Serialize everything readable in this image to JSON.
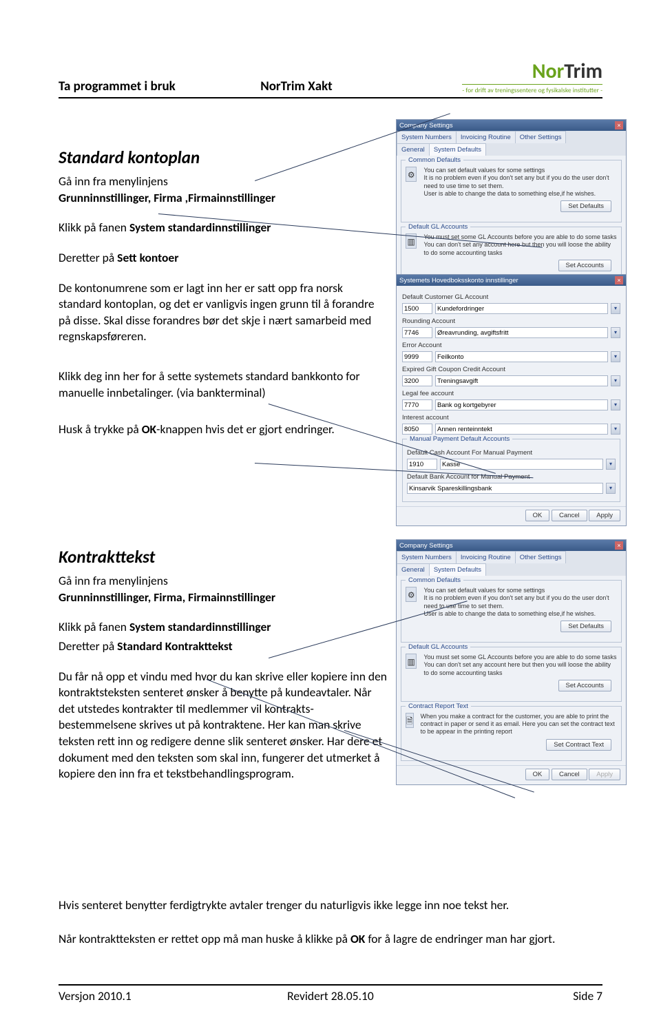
{
  "header": {
    "left": "Ta programmet i bruk",
    "mid": "NorTrim Xakt",
    "logo_nor": "Nor",
    "logo_trim": "Trim",
    "logo_sub": "- for drift av treningssentere og fysikalske institutter -"
  },
  "section1": {
    "title": "Standard kontoplan",
    "p1a": "Gå inn fra menylinjens",
    "p1b": "Grunninnstillinger, Firma ,Firmainnstillinger",
    "p2a": "Klikk på fanen ",
    "p2b": "System standardinnstillinger",
    "p3a": "Deretter på ",
    "p3b": "Sett kontoer",
    "p4": "De kontonumrene som er lagt inn her er satt opp fra norsk standard kontoplan, og det er vanligvis ingen grunn til å forandre på disse. Skal disse forandres bør det skje i nært samarbeid med regnskapsføreren.",
    "p5": "Klikk deg inn her for å sette systemets standard bankkonto for manuelle innbetalinger. (via bankterminal)",
    "p6a": "Husk å trykke på ",
    "p6b": "OK",
    "p6c": "-knappen hvis det er gjort endringer."
  },
  "section2": {
    "title": "Kontrakttekst",
    "p1a": "Gå inn fra menylinjens",
    "p1b": "Grunninnstillinger, Firma, Firmainnstillinger",
    "p2a": "Klikk på fanen ",
    "p2b": "System standardinnstillinger",
    "p3a": "Deretter på ",
    "p3b": "Standard Kontrakttekst",
    "p4": "Du får nå opp et vindu med hvor du kan skrive eller kopiere inn den kontraktsteksten senteret ønsker å benytte på kundeavtaler. Når det utstedes kontrakter til medlemmer vil kontrakts-bestemmelsene skrives ut på kontraktene. Her kan man skrive teksten rett inn og redigere denne slik senteret ønsker. Har dere et dokument med den teksten som skal inn, fungerer det utmerket å kopiere den inn fra et tekstbehandlingsprogram.",
    "p5": "Hvis senteret benytter ferdigtrykte avtaler trenger du naturligvis ikke legge inn noe tekst her.",
    "p6a": "Når kontraktteksten er rettet opp må man huske å klikke på ",
    "p6b": "OK",
    "p6c": " for å lagre de endringer man har gjort."
  },
  "footer": {
    "left": "Versjon 2010.1",
    "mid": "Revidert 28.05.10",
    "right": "Side 7"
  },
  "win_company": {
    "title": "Company Settings",
    "tabs": [
      "System Numbers",
      "Invoicing Routine",
      "Other Settings",
      "General",
      "System Defaults"
    ],
    "common_label": "Common Defaults",
    "common_text": "You can set default values for some settings\nIt is no problem even if you don't set any but if you do the user don't need to use time to set them.\nUser is able to change the data to something else,if he wishes.",
    "set_defaults_btn": "Set Defaults",
    "gl_label": "Default GL Accounts",
    "gl_text": "You must set some GL Accounts before you are able to do some tasks\nYou can don't set any account here but then you will loose the ability to do some accounting tasks",
    "set_accounts_btn": "Set Accounts",
    "contract_label": "Contract Report Text",
    "contract_text": "When you make a contract for the customer, you are able to print the contract in paper or send it as email. Here you can set the contract text to be appear in the printing report",
    "set_contract_btn": "Set Contract Text",
    "ok": "OK",
    "cancel": "Cancel",
    "apply": "Apply"
  },
  "win_hoved": {
    "title": "Systemets Hovedboksskonto innstillinger",
    "fields": [
      {
        "label": "Default Customer GL Account",
        "num": "1500",
        "name": "Kundefordringer"
      },
      {
        "label": "Rounding Account",
        "num": "7746",
        "name": "Øreavrunding, avgiftsfritt"
      },
      {
        "label": "Error Account",
        "num": "9999",
        "name": "Feilkonto"
      },
      {
        "label": "Expired Gift Coupon Credit Account",
        "num": "3200",
        "name": "Treningsavgift"
      },
      {
        "label": "Legal fee account",
        "num": "7770",
        "name": "Bank og kortgebyrer"
      },
      {
        "label": "Interest account",
        "num": "8050",
        "name": "Annen renteinntekt"
      }
    ],
    "manual_label": "Manual Payment Default Accounts",
    "cash_label": "Default Cash Account For Manual Payment",
    "cash_num": "1910",
    "cash_name": "Kasse",
    "bank_label": "Default Bank Account for Manual Payment",
    "bank_name": "Kinsarvik Spareskillingsbank",
    "ok": "OK",
    "cancel": "Cancel",
    "apply": "Apply"
  }
}
